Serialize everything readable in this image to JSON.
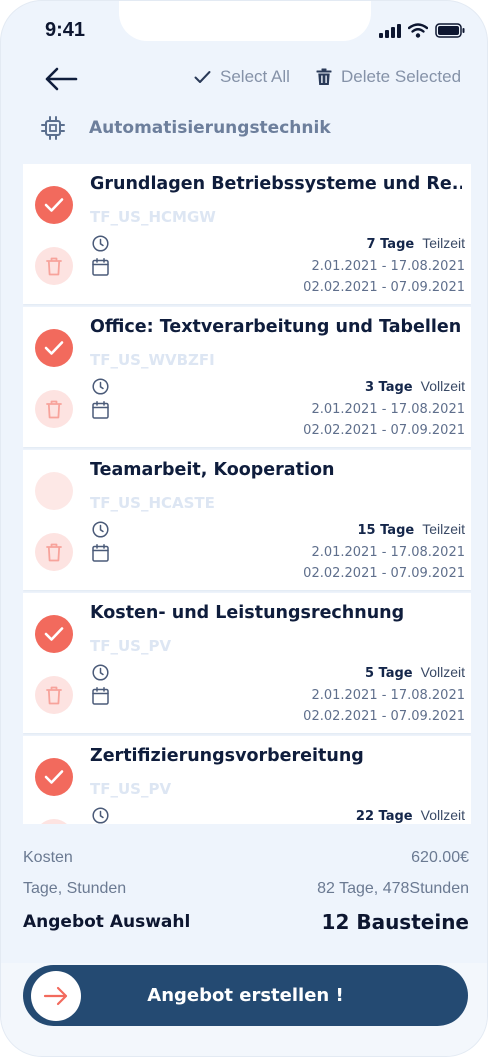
{
  "status_bar": {
    "time": "9:41"
  },
  "toolbar": {
    "select_all_label": "Select All",
    "delete_selected_label": "Delete Selected"
  },
  "category": {
    "label": "Automatisierungstechnik"
  },
  "courses": [
    {
      "title": "Grundlagen Betriebssysteme und Re...",
      "code": "TF_US_HCMGW",
      "days": "7 Tage",
      "type": "Teilzeit",
      "date1": "2.01.2021 - 17.08.2021",
      "date2": "02.02.2021 - 07.09.2021",
      "selected": true
    },
    {
      "title": "Office: Textverarbeitung und Tabellen...",
      "code": "TF_US_WVBZFI",
      "days": "3 Tage",
      "type": "Vollzeit",
      "date1": "2.01.2021 - 17.08.2021",
      "date2": "02.02.2021 - 07.09.2021",
      "selected": true
    },
    {
      "title": "Teamarbeit, Kooperation",
      "code": "TF_US_HCASTE",
      "days": "15 Tage",
      "type": "Teilzeit",
      "date1": "2.01.2021 - 17.08.2021",
      "date2": "02.02.2021 - 07.09.2021",
      "selected": false
    },
    {
      "title": "Kosten- und Leistungsrechnung",
      "code": "TF_US_PV",
      "days": "5 Tage",
      "type": "Vollzeit",
      "date1": "2.01.2021 - 17.08.2021",
      "date2": "02.02.2021 - 07.09.2021",
      "selected": true
    },
    {
      "title": "Zertifizierungsvorbereitung",
      "code": "TF_US_PV",
      "days": "22 Tage",
      "type": "Vollzeit",
      "date1": "",
      "date2": "",
      "selected": true
    }
  ],
  "summary": {
    "cost_label": "Kosten",
    "cost_value": "620.00€",
    "days_label": "Tage, Stunden",
    "days_value": "82 Tage, 478Stunden",
    "offer_label": "Angebot Auswahl",
    "offer_value": "12 Bausteine"
  },
  "cta": {
    "label": "Angebot erstellen !"
  },
  "colors": {
    "accent": "#f26a5d",
    "primary": "#244a72",
    "background": "#eef4fc"
  }
}
